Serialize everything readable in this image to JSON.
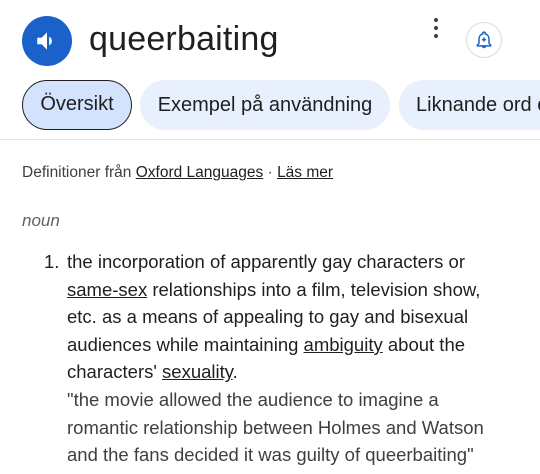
{
  "header": {
    "word": "queerbaiting",
    "speaker_icon": "speaker-icon",
    "more_icon": "more-vertical-icon",
    "alert_icon": "bell-plus-icon"
  },
  "tabs": [
    {
      "label": "Översikt",
      "active": true
    },
    {
      "label": "Exempel på användning",
      "active": false
    },
    {
      "label": "Liknande ord o",
      "active": false
    }
  ],
  "source": {
    "prefix": "Definitioner från ",
    "provider": "Oxford Languages",
    "separator": " · ",
    "read_more": "Läs mer"
  },
  "entry": {
    "part_of_speech": "noun",
    "definitions": [
      {
        "number": "1.",
        "text_1": "the incorporation of apparently gay characters or",
        "link_same_sex": "same-sex",
        "text_2": " relationships into a film, television show,",
        "text_3": "etc. as a means of appealing to gay and bisexual",
        "text_4": "audiences while maintaining ",
        "link_ambiguity": "ambiguity",
        "text_5": " about the",
        "text_6": "characters' ",
        "link_sexuality": "sexuality",
        "text_7": ".",
        "example_1": "\"the movie allowed the audience to imagine a",
        "example_2": "romantic relationship between Holmes and Watson",
        "example_3": "and the fans decided it was guilty of queerbaiting\""
      }
    ]
  },
  "colors": {
    "accent": "#1a62c9",
    "tab_active_bg": "#d3e3fd",
    "tab_bg": "#e8f0fe"
  }
}
